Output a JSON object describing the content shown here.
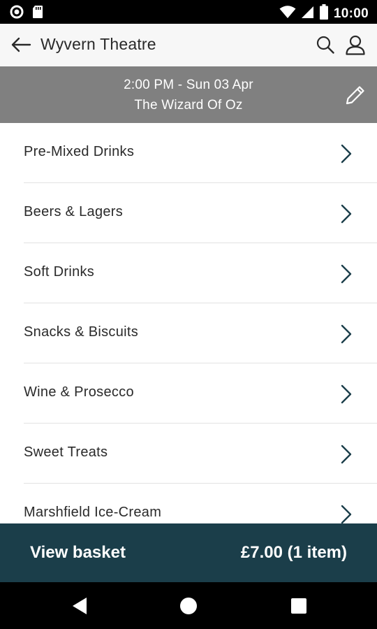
{
  "status_bar": {
    "time": "10:00",
    "icons": [
      "circle-notification-icon",
      "sd-card-icon",
      "wifi-icon",
      "cellular-signal-icon",
      "battery-icon"
    ]
  },
  "app_bar": {
    "title": "Wyvern Theatre",
    "icons": [
      "back-arrow-icon",
      "search-icon",
      "account-icon"
    ]
  },
  "event": {
    "time": "2:00 PM - Sun 03 Apr",
    "name": "The Wizard Of Oz",
    "icon": "pencil-icon"
  },
  "categories": [
    {
      "label": "Pre-Mixed Drinks"
    },
    {
      "label": "Beers & Lagers"
    },
    {
      "label": "Soft Drinks"
    },
    {
      "label": "Snacks & Biscuits"
    },
    {
      "label": "Wine & Prosecco"
    },
    {
      "label": "Sweet Treats"
    },
    {
      "label": "Marshfield Ice-Cream"
    }
  ],
  "basket": {
    "label": "View basket",
    "total": "£7.00 (1 item)"
  },
  "colors": {
    "app_bar_bg": "#f7f7f7",
    "banner_bg": "#808080",
    "basket_bg": "#1b3e4a",
    "chevron": "#1b3e4a"
  }
}
